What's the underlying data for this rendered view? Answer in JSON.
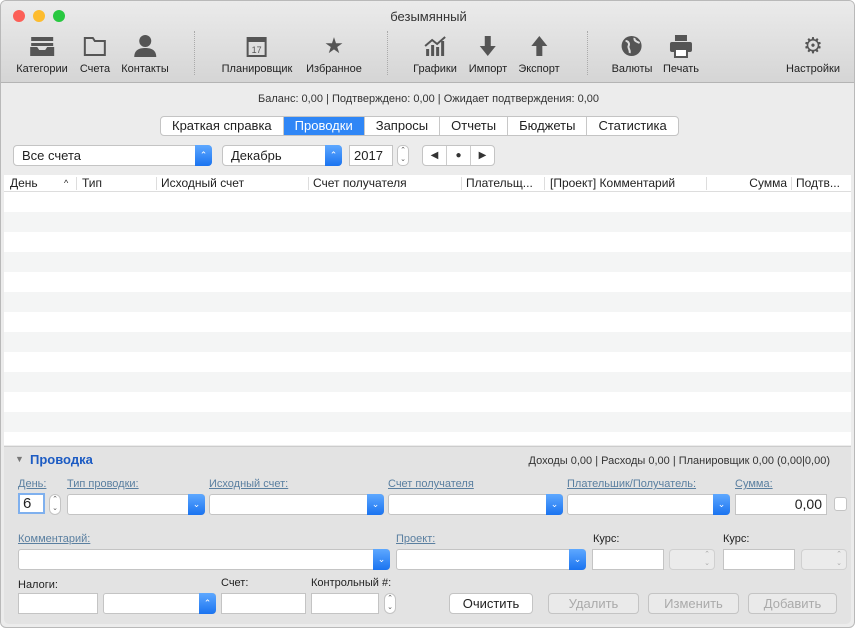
{
  "window": {
    "title": "безымянный"
  },
  "toolbar": [
    {
      "label": "Категории",
      "icon": "inbox-tray-icon"
    },
    {
      "label": "Счета",
      "icon": "folder-icon"
    },
    {
      "label": "Контакты",
      "icon": "person-icon"
    },
    {
      "label": "Планировщик",
      "icon": "calendar-icon",
      "badge": "17"
    },
    {
      "label": "Избранное",
      "icon": "star-icon"
    },
    {
      "label": "Графики",
      "icon": "chart-icon"
    },
    {
      "label": "Импорт",
      "icon": "arrow-down-icon"
    },
    {
      "label": "Экспорт",
      "icon": "arrow-up-icon"
    },
    {
      "label": "Валюты",
      "icon": "globe-icon"
    },
    {
      "label": "Печать",
      "icon": "printer-icon"
    },
    {
      "label": "Настройки",
      "icon": "gear-icon"
    }
  ],
  "balance": "Баланс: 0,00 | Подтверждено: 0,00 | Ожидает подтверждения: 0,00",
  "tabs": [
    "Краткая справка",
    "Проводки",
    "Запросы",
    "Отчеты",
    "Бюджеты",
    "Статистика"
  ],
  "selected_tab": "Проводки",
  "filters": {
    "account": "Все счета",
    "month": "Декабрь",
    "year": "2017"
  },
  "table": {
    "columns": [
      "День",
      "Тип",
      "Исходный счет",
      "Счет получателя",
      "Плательщ...",
      "[Проект] Комментарий",
      "Сумма",
      "Подтв..."
    ]
  },
  "panel": {
    "title": "Проводка",
    "summary": "Доходы 0,00 | Расходы 0,00 | Планировщик 0,00 (0,00|0,00)",
    "labels": {
      "day": "День:",
      "type": "Тип проводки:",
      "source": "Исходный счет:",
      "dest": "Счет получателя",
      "payee": "Плательшик/Получатель:",
      "amount": "Сумма:",
      "comment": "Комментарий:",
      "project": "Проект:",
      "rate1": "Курс:",
      "rate2": "Курс:",
      "taxes": "Налоги:",
      "account": "Счет:",
      "control": "Контрольный #:"
    },
    "values": {
      "day": "6",
      "amount": "0,00"
    },
    "buttons": {
      "clear": "Очистить",
      "delete": "Удалить",
      "edit": "Изменить",
      "add": "Добавить"
    }
  }
}
